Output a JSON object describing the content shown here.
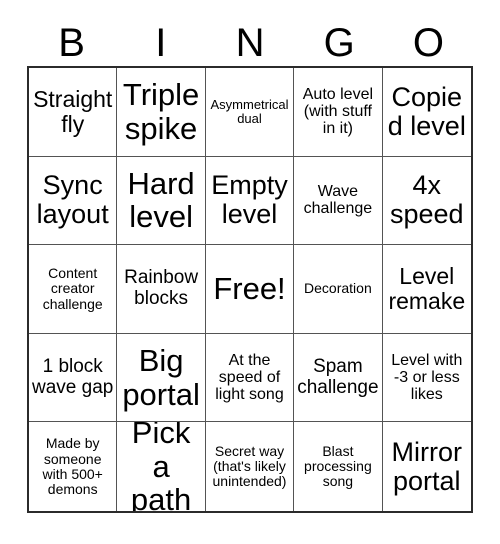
{
  "card": {
    "title": "BINGO",
    "header_letters": [
      "B",
      "I",
      "N",
      "G",
      "O"
    ],
    "free_space_label": "Free!",
    "colors": {
      "background": "#ffffff",
      "text": "#000000",
      "grid_outer_border": "#2b2b2b",
      "grid_inner_border": "#545454"
    },
    "grid": {
      "columns": 5,
      "rows": 5
    },
    "cells": [
      {
        "text": "Straight fly",
        "size": "fs-l"
      },
      {
        "text": "Triple spike",
        "size": "fs-xxl"
      },
      {
        "text": "Asymmetrical dual",
        "size": "fs-xxs"
      },
      {
        "text": "Auto level (with stuff in it)",
        "size": "fs-s"
      },
      {
        "text": "Copied level",
        "size": "fs-xl"
      },
      {
        "text": "Sync layout",
        "size": "fs-xl"
      },
      {
        "text": "Hard level",
        "size": "fs-xxl"
      },
      {
        "text": "Empty level",
        "size": "fs-xl"
      },
      {
        "text": "Wave challenge",
        "size": "fs-s"
      },
      {
        "text": "4x speed",
        "size": "fs-xl"
      },
      {
        "text": "Content creator challenge",
        "size": "fs-xs"
      },
      {
        "text": "Rainbow blocks",
        "size": "fs-m"
      },
      {
        "text": "Free!",
        "size": "fs-xxl"
      },
      {
        "text": "Decoration",
        "size": "fs-xs"
      },
      {
        "text": "Level remake",
        "size": "fs-l"
      },
      {
        "text": "1 block wave gap",
        "size": "fs-m"
      },
      {
        "text": "Big portal",
        "size": "fs-xxl"
      },
      {
        "text": "At the speed of light song",
        "size": "fs-s"
      },
      {
        "text": "Spam challenge",
        "size": "fs-m"
      },
      {
        "text": "Level with -3 or less likes",
        "size": "fs-s"
      },
      {
        "text": "Made by someone with 500+ demons",
        "size": "fs-xs"
      },
      {
        "text": "Pick a path",
        "size": "fs-xxl"
      },
      {
        "text": "Secret way (that's likely unintended)",
        "size": "fs-xs"
      },
      {
        "text": "Blast processing song",
        "size": "fs-xs"
      },
      {
        "text": "Mirror portal",
        "size": "fs-xl"
      }
    ]
  }
}
